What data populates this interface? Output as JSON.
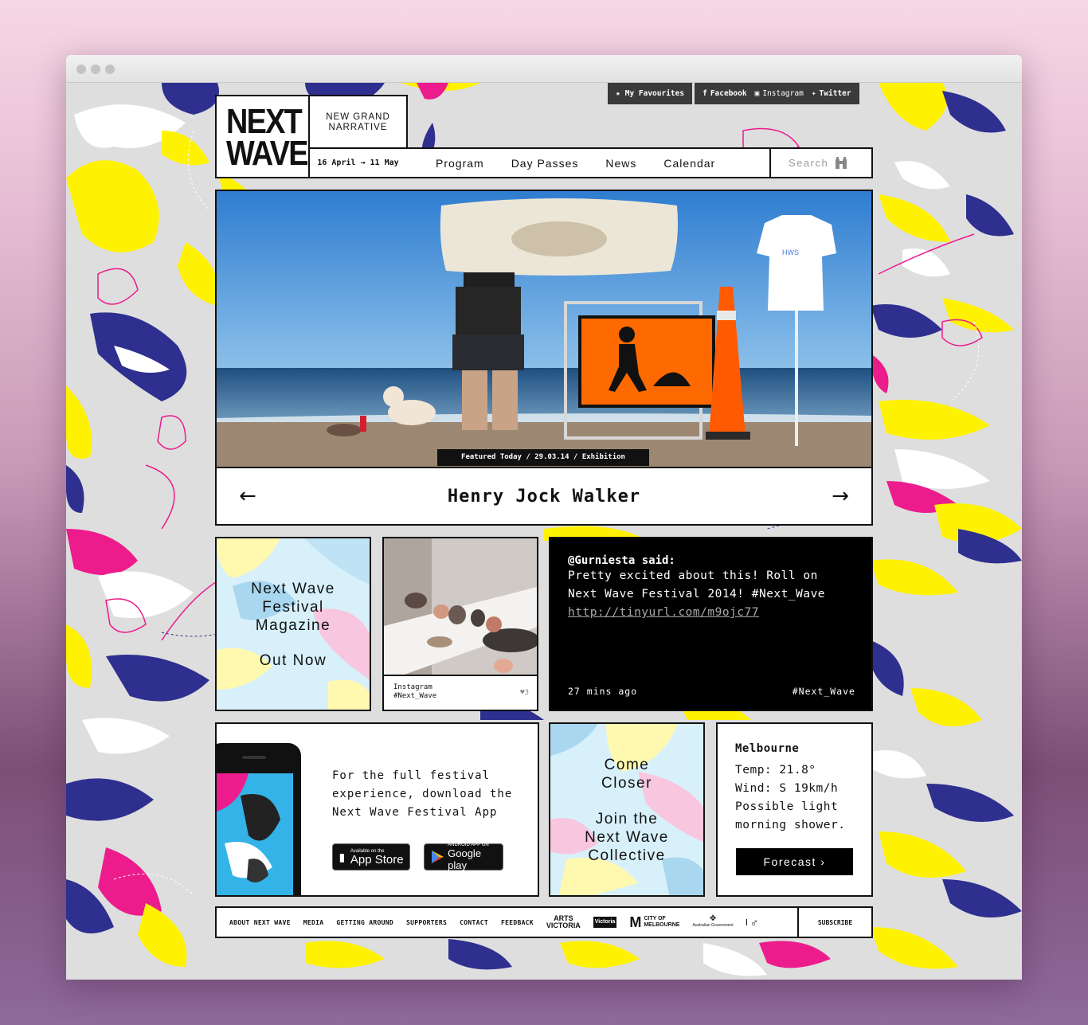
{
  "topbar": {
    "favourites": "My Favourites",
    "facebook": "Facebook",
    "instagram": "Instagram",
    "twitter": "Twitter"
  },
  "header": {
    "logo_line1": "NEXT",
    "logo_line2": "WAVE",
    "tagline_line1": "NEW GRAND",
    "tagline_line2": "NARRATIVE",
    "dates": "16 April → 11 May",
    "nav": [
      "Program",
      "Day Passes",
      "News",
      "Calendar"
    ],
    "search_placeholder": "Search"
  },
  "hero": {
    "caption": "Featured Today / 29.03.14 / Exhibition",
    "title": "Henry Jock Walker",
    "prev_arrow": "←",
    "next_arrow": "→"
  },
  "magazine": {
    "line1": "Next Wave",
    "line2": "Festival",
    "line3": "Magazine",
    "line4": "Out Now"
  },
  "instagram_post": {
    "source": "Instagram",
    "tag": "#Next_Wave",
    "likes": "3"
  },
  "tweet": {
    "handle": "@Gurniesta said:",
    "line1": "Pretty excited about this! Roll on",
    "line2": "Next Wave Festival 2014! #Next_Wave",
    "link": "http://tinyurl.com/m9ojc77",
    "time": "27 mins ago",
    "hashtag": "#Next_Wave"
  },
  "app_promo": {
    "line1": "For the full festival",
    "line2": "experience, download the",
    "line3": "Next Wave Festival App",
    "appstore_small": "Available on the",
    "appstore_big": "App Store",
    "googleplay_small": "ANDROID APP ON",
    "googleplay_big": "Google play"
  },
  "collective": {
    "line1": "Come",
    "line2": "Closer",
    "line3": "Join the",
    "line4": "Next Wave",
    "line5": "Collective"
  },
  "weather": {
    "city": "Melbourne",
    "temp": "Temp: 21.8°",
    "wind": "Wind: S 19km/h",
    "desc1": "Possible light",
    "desc2": "morning shower.",
    "button": "Forecast ›"
  },
  "footer": {
    "links": [
      "ABOUT NEXT WAVE",
      "MEDIA",
      "GETTING AROUND",
      "SUPPORTERS",
      "CONTACT",
      "FEEDBACK"
    ],
    "arts_victoria_1": "ARTS",
    "arts_victoria_2": "VICTORIA",
    "victoria": "Victoria",
    "city_melbourne_1": "CITY OF",
    "city_melbourne_2": "MELBOURNE",
    "aus_gov": "Australian Government",
    "subscribe": "SUBSCRIBE"
  },
  "colors": {
    "yellow": "#fff200",
    "navy": "#2e2f8f",
    "magenta": "#ec1c8c",
    "white": "#ffffff",
    "sky": "#3b8fd6",
    "sign_orange": "#ff6a00"
  }
}
